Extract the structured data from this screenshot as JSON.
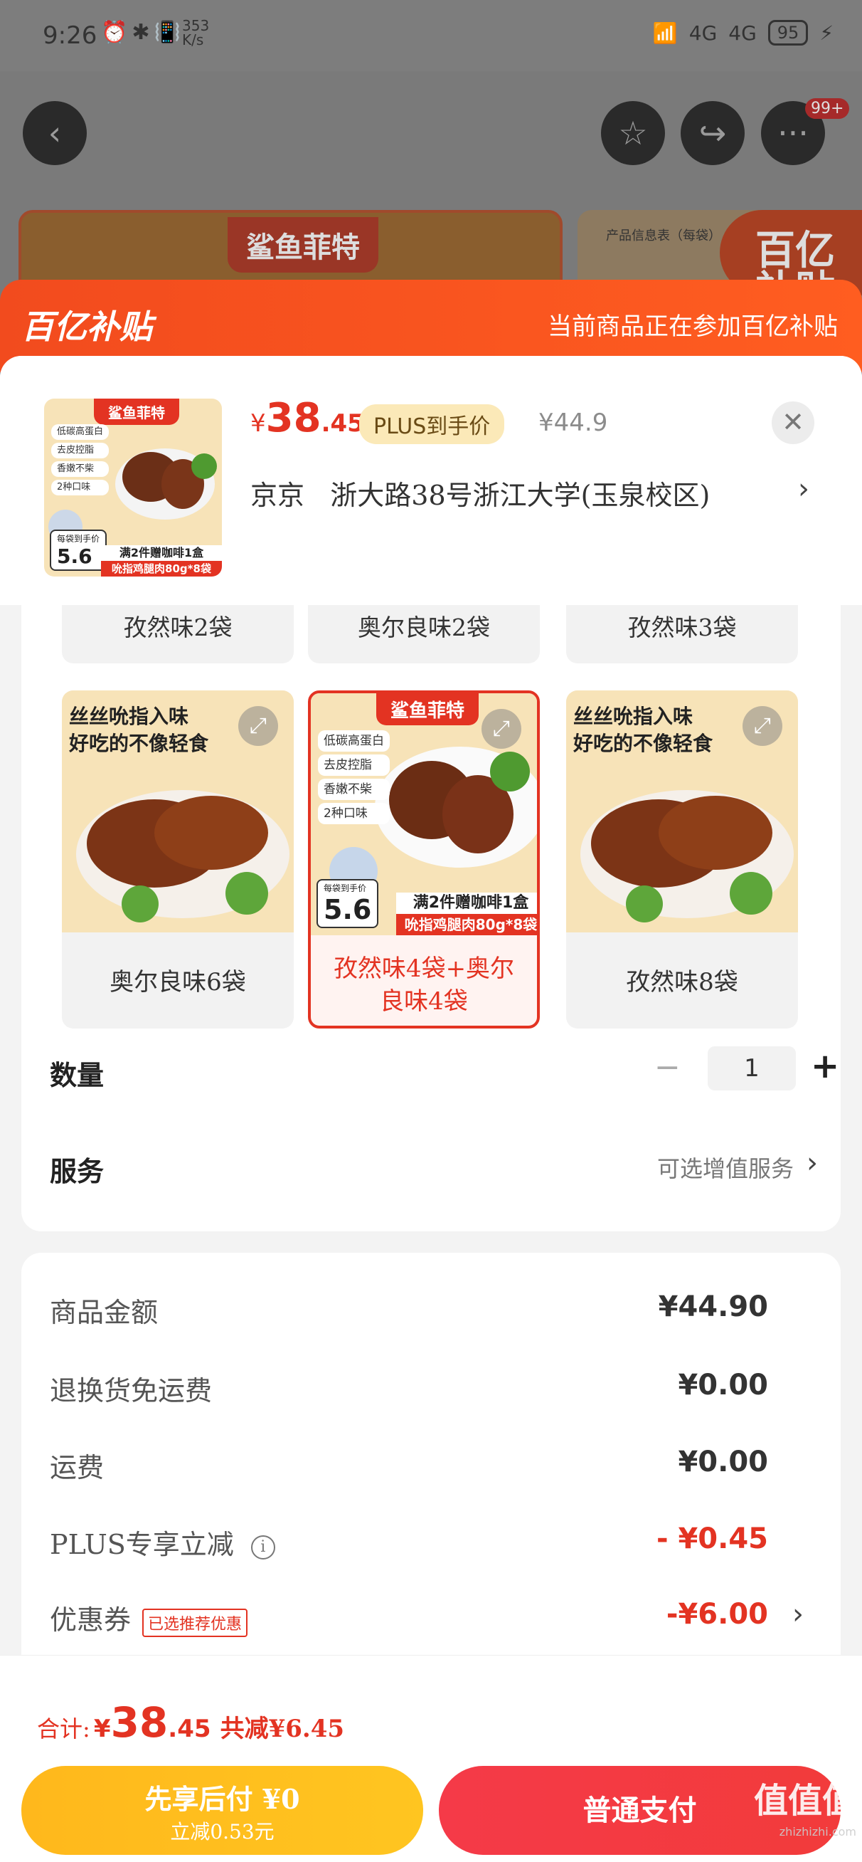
{
  "status": {
    "time": "9:26",
    "net_speed_top": "353",
    "net_speed_bottom": "K/s",
    "signal1": "4G",
    "signal2": "4G",
    "battery": "95"
  },
  "nav": {
    "badge": "99+"
  },
  "bg": {
    "brand": "鲨鱼菲特",
    "product_info": "产品信息表（每袋）",
    "subsidy_logo_line1": "百亿",
    "subsidy_logo_line2": "补贴"
  },
  "subsidy": {
    "logo": "百亿补贴",
    "note": "当前商品正在参加百亿补贴"
  },
  "product": {
    "price_currency": "¥",
    "price_int": "38",
    "price_dec": ".45",
    "plus_tag": "PLUS到手价",
    "orig_price": "¥44.9",
    "address_prefix": "京京",
    "address": "浙大路38号浙江大学(玉泉校区)",
    "thumb": {
      "brand": "鲨鱼菲特",
      "features": [
        "低碳高蛋白",
        "去皮控脂",
        "香嫩不柴",
        "2种口味"
      ],
      "price_label": "每袋到手价",
      "price": "5.6",
      "promo_top": "满2件赠咖啡1盒",
      "promo_bottom": "吮指鸡腿肉80g*8袋"
    }
  },
  "options_top": [
    "孜然味2袋",
    "奥尔良味2袋",
    "孜然味3袋"
  ],
  "options": [
    {
      "label": "奥尔良味6袋",
      "slogan1": "丝丝吮指入味",
      "slogan2": "好吃的不像轻食",
      "selected": false
    },
    {
      "label": "孜然味4袋+奥尔良味4袋",
      "selected": true
    },
    {
      "label": "孜然味8袋",
      "slogan1": "丝丝吮指入味",
      "slogan2": "好吃的不像轻食",
      "selected": false
    }
  ],
  "quantity": {
    "title": "数量",
    "minus": "−",
    "value": "1",
    "plus": "+"
  },
  "service": {
    "title": "服务",
    "text": "可选增值服务",
    "arrow": "›"
  },
  "fees": {
    "goods_label": "商品金额",
    "goods_value": "¥44.90",
    "return_label": "退换货免运费",
    "return_value": "¥0.00",
    "shipping_label": "运费",
    "shipping_value": "¥0.00",
    "plus_label": "PLUS专享立减",
    "plus_value": "- ¥0.45",
    "coupon_label": "优惠券",
    "coupon_tag": "已选推荐优惠",
    "coupon_value": "-¥6.00"
  },
  "total": {
    "label": "合计:",
    "currency": "¥",
    "int": "38",
    "dec": ".45",
    "saved": "共减¥6.45"
  },
  "buttons": {
    "pay_later": "先享后付 ¥0",
    "pay_later_sub": "立减0.53元",
    "pay": "普通支付"
  },
  "watermark": {
    "text": "值值值",
    "site": "zhizhizhi.com"
  }
}
